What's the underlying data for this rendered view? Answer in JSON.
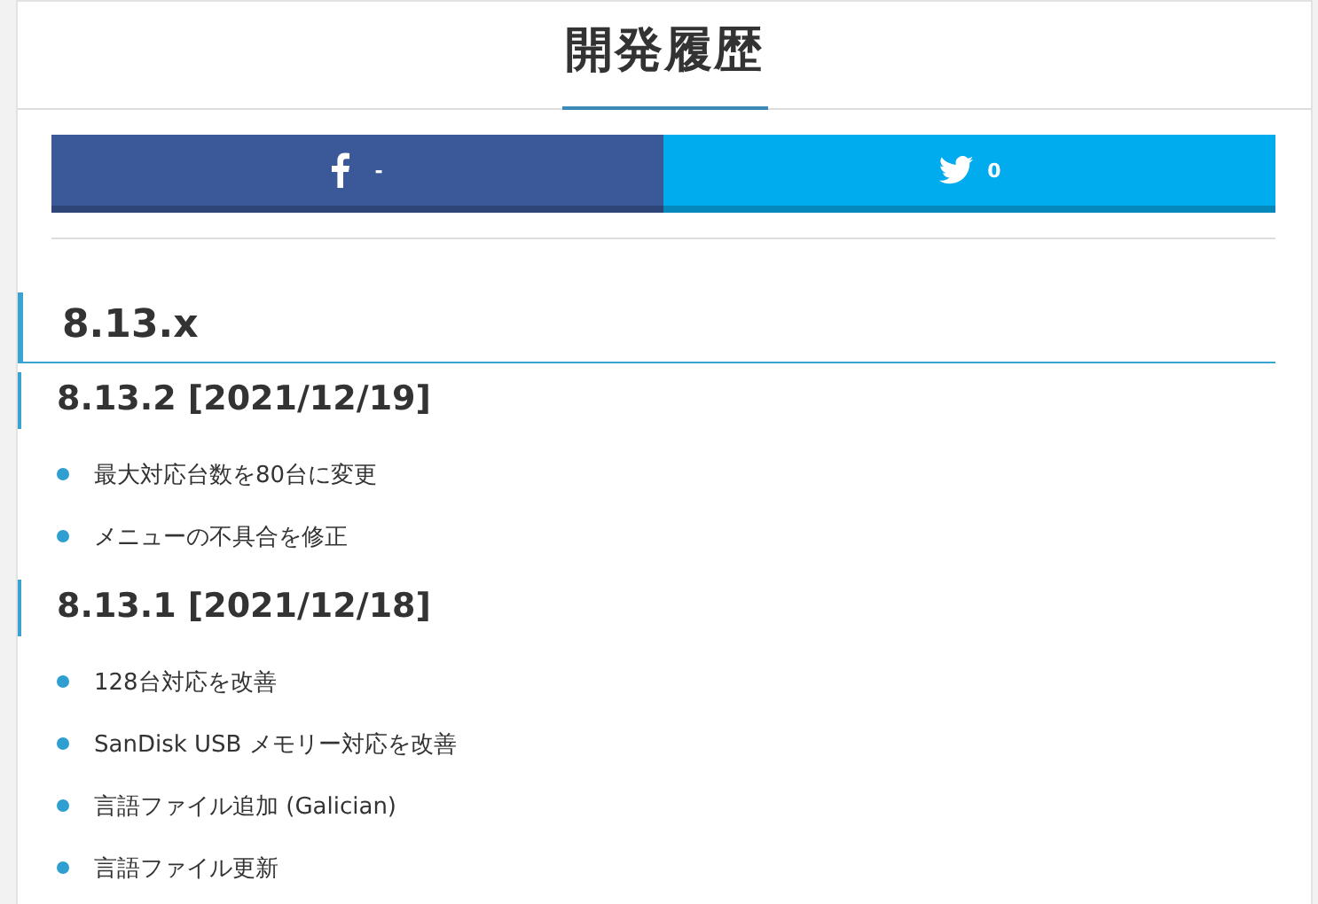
{
  "title": "開発履歴",
  "share": [
    {
      "kind": "facebook",
      "count": "-"
    },
    {
      "kind": "twitter",
      "count": "0"
    }
  ],
  "section": {
    "heading": "8.13.x",
    "releases": [
      {
        "heading": "8.13.2 [2021/12/19]",
        "items": [
          "最大対応台数を80台に変更",
          "メニューの不具合を修正"
        ]
      },
      {
        "heading": "8.13.1 [2021/12/18]",
        "items": [
          "128台対応を改善",
          "SanDisk USB メモリー対応を改善",
          "言語ファイル追加 (Galician)",
          "言語ファイル更新"
        ]
      }
    ]
  }
}
